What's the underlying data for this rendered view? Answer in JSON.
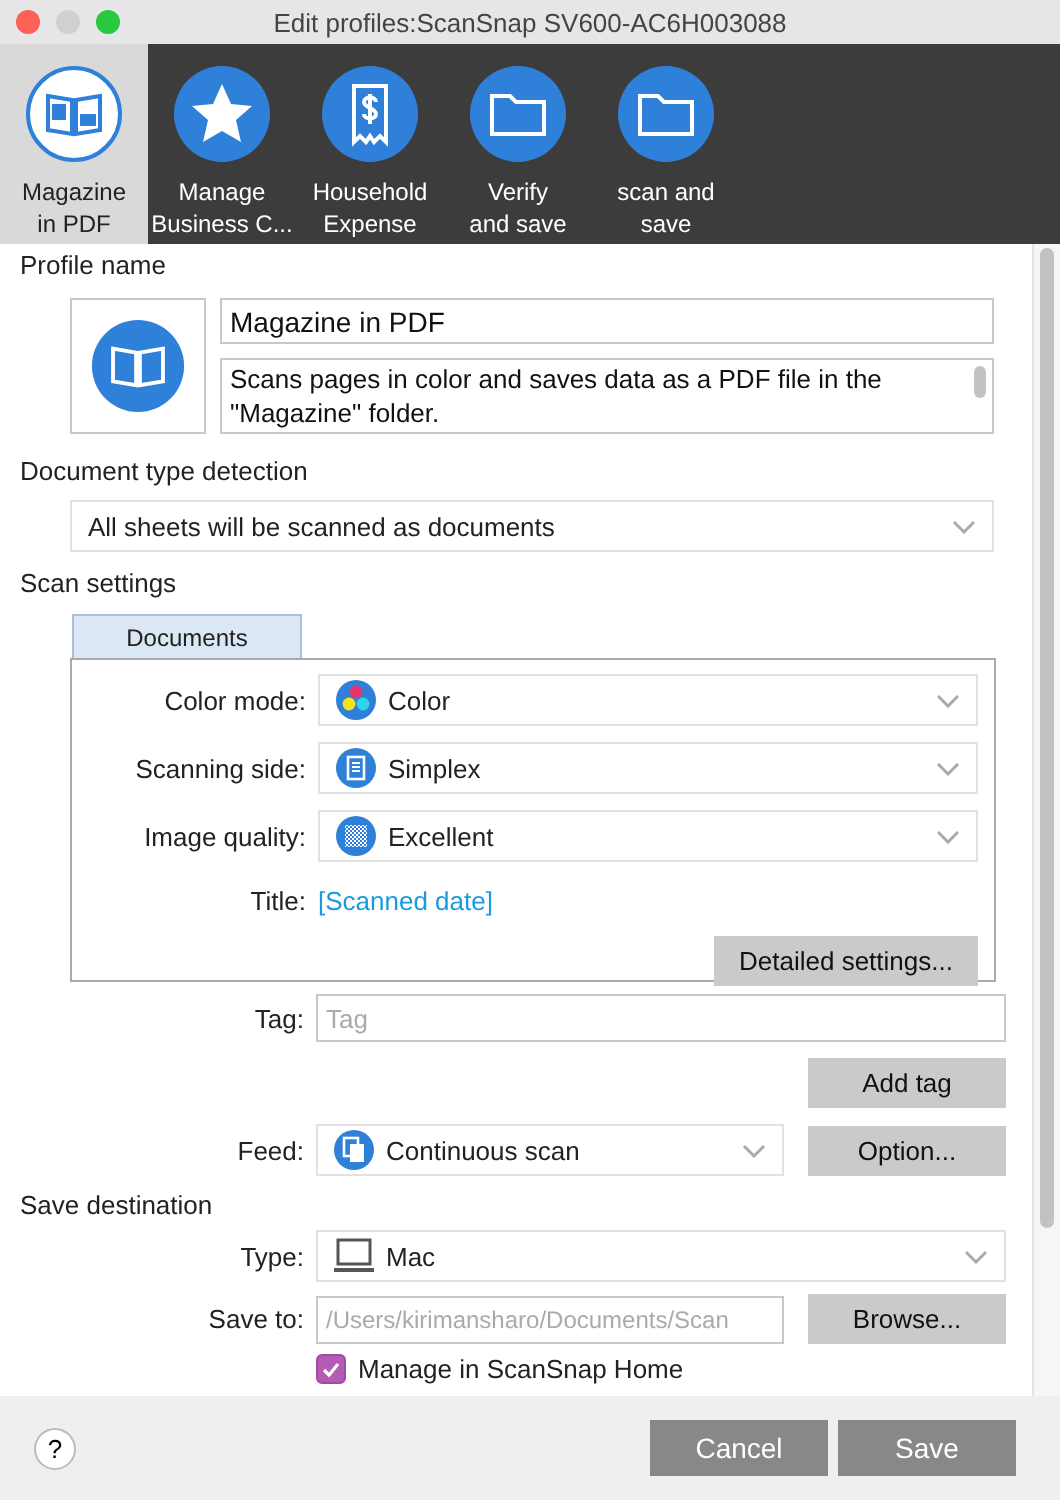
{
  "window": {
    "title": "Edit profiles:ScanSnap SV600-AC6H003088"
  },
  "profiles": [
    {
      "label": "Magazine\nin PDF",
      "kind": "book",
      "selected": true
    },
    {
      "label": "Manage\nBusiness C...",
      "kind": "star",
      "selected": false
    },
    {
      "label": "Household\nExpense",
      "kind": "receipt",
      "selected": false
    },
    {
      "label": "Verify\nand save",
      "kind": "folder",
      "selected": false
    },
    {
      "label": "scan and\nsave",
      "kind": "folder",
      "selected": false
    }
  ],
  "profile_name": {
    "label": "Profile name",
    "name": "Magazine in PDF",
    "description": "Scans pages in color and saves data as a PDF file in the \"Magazine\" folder."
  },
  "document_type_detection": {
    "label": "Document type detection",
    "value": "All sheets will be scanned as documents"
  },
  "scan_settings": {
    "label": "Scan settings",
    "tabs": [
      {
        "label": "Documents",
        "selected": true
      }
    ],
    "rows": [
      {
        "label": "Color mode:",
        "value": "Color",
        "kind": "color"
      },
      {
        "label": "Scanning side:",
        "value": "Simplex",
        "kind": "page"
      },
      {
        "label": "Image quality:",
        "value": "Excellent",
        "kind": "quality"
      }
    ],
    "title": {
      "label": "Title:",
      "value": "[Scanned date]"
    },
    "detail_button": "Detailed settings..."
  },
  "tag": {
    "label": "Tag:",
    "placeholder": "Tag",
    "button": "Add tag"
  },
  "feed": {
    "label": "Feed:",
    "value": "Continuous scan",
    "kind": "pages",
    "button": "Option..."
  },
  "save_destination": {
    "label": "Save destination",
    "type": {
      "label": "Type:",
      "value": "Mac",
      "kind": "monitor"
    },
    "save_to_label": "Save to:",
    "save_to_value": "/Users/kirimansharo/Documents/Scan",
    "browse_button": "Browse...",
    "manage": {
      "label": "Manage in ScanSnap Home",
      "checked": true
    }
  },
  "footer": {
    "help": "?",
    "buttons": [
      "Cancel",
      "Save"
    ]
  }
}
